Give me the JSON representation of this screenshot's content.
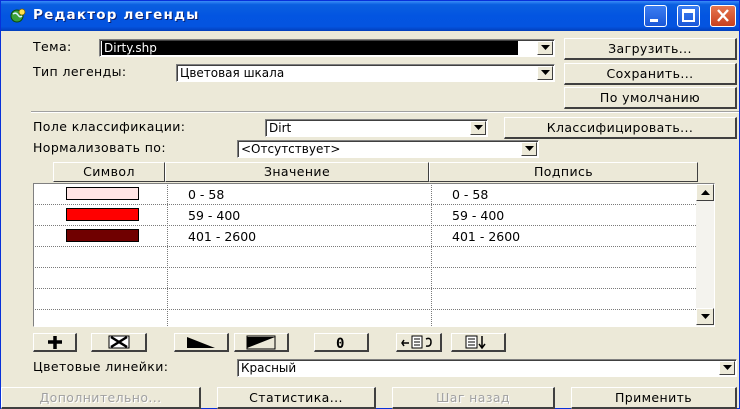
{
  "window": {
    "title": "Редактор легенды",
    "titlebar_color": "#0355e1",
    "controls": [
      "minimize-icon",
      "maximize-icon",
      "close-icon"
    ]
  },
  "theme": {
    "label": "Тема:",
    "value": "Dirty.shp",
    "load_label": "Загрузить..."
  },
  "legend_type": {
    "label": "Тип легенды:",
    "value": "Цветовая шкала",
    "save_label": "Сохранить..."
  },
  "default_label": "По умолчанию",
  "classification": {
    "label": "Поле классификации:",
    "value": "Dirt",
    "button": "Классифицировать..."
  },
  "normalize": {
    "label": "Нормализовать по:",
    "value": "<Отсутствует>"
  },
  "table": {
    "columns": [
      "Символ",
      "Значение",
      "Подпись"
    ],
    "rows": [
      {
        "color": "#ffe4e4",
        "value": "0 - 58",
        "label": "0 - 58"
      },
      {
        "color": "#ff0000",
        "value": "59 - 400",
        "label": "59 - 400"
      },
      {
        "color": "#700000",
        "value": "401 - 2600",
        "label": "401 - 2600"
      }
    ]
  },
  "toolbar_icons": [
    "add-icon",
    "delete-icon",
    "ramp-ascending-icon",
    "ramp-descending-icon",
    "zero-icon",
    "reverse-icon",
    "sort-icon"
  ],
  "color_ramp": {
    "label": "Цветовые линейки:",
    "value": "Красный"
  },
  "footer": {
    "advanced": "Дополнительно...",
    "statistics": "Статистика...",
    "undo": "Шаг назад",
    "apply": "Применить"
  }
}
